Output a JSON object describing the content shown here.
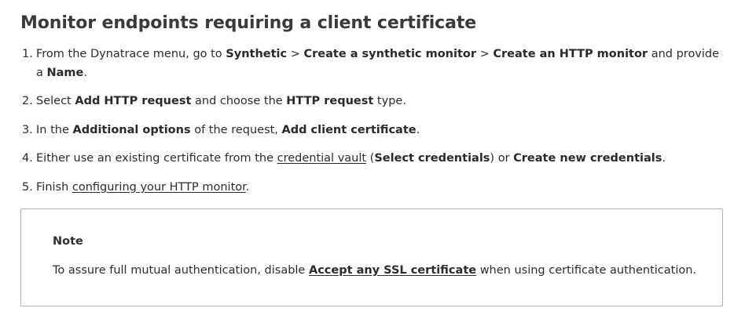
{
  "title": "Monitor endpoints requiring a client certificate",
  "steps": [
    {
      "num": "1.",
      "p1": "From the Dynatrace menu, go to ",
      "b1": "Synthetic",
      "p2": " > ",
      "b2": "Create a synthetic monitor",
      "p3": " > ",
      "b3": "Create an HTTP monitor",
      "p4": " and provide a ",
      "b4": "Name",
      "p5": "."
    },
    {
      "num": "2.",
      "p1": "Select ",
      "b1": "Add HTTP request",
      "p2": " and choose the ",
      "b2": "HTTP request",
      "p3": " type."
    },
    {
      "num": "3.",
      "p1": "In the ",
      "b1": "Additional options",
      "p2": " of the request, ",
      "b2": "Add client certificate",
      "p3": "."
    },
    {
      "num": "4.",
      "p1": "Either use an existing certificate from the ",
      "link1": "credential vault",
      "p2": " (",
      "b1": "Select credentials",
      "p3": ") or ",
      "b2": "Create new credentials",
      "p4": "."
    },
    {
      "num": "5.",
      "p1": "Finish ",
      "link1": "configuring your HTTP monitor",
      "p2": "."
    }
  ],
  "note": {
    "title": "Note",
    "p1": "To assure full mutual authentication, disable ",
    "link1": "Accept any SSL certificate",
    "p2": " when using certificate authentication."
  }
}
